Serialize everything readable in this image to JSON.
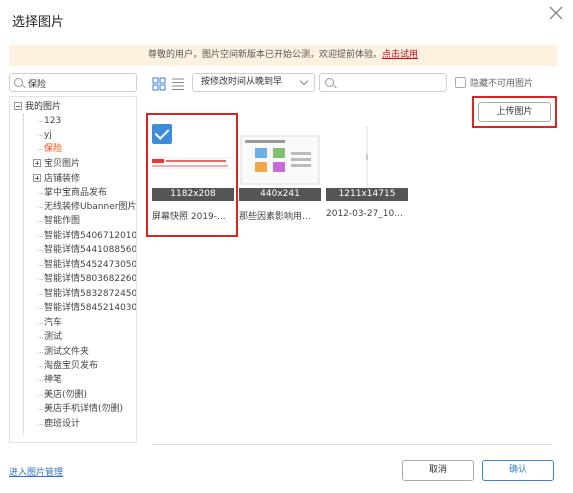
{
  "dialog": {
    "title": "选择图片"
  },
  "notice": {
    "text": "尊敬的用户，图片空间新版本已开始公测，欢迎提前体验。",
    "link": "点击试用"
  },
  "sidebar": {
    "search_value": "保险",
    "tree_root": "我的图片",
    "items": [
      {
        "label": "123"
      },
      {
        "label": "yj"
      },
      {
        "label": "保险",
        "selected": true
      },
      {
        "label": "宝贝图片",
        "collapsed": true
      },
      {
        "label": "店铺装修",
        "collapsed": true
      },
      {
        "label": "掌中宝商品发布"
      },
      {
        "label": "无线装修Ubanner图片"
      },
      {
        "label": "智能作图"
      },
      {
        "label": "智能详情5406712010"
      },
      {
        "label": "智能详情5441088560"
      },
      {
        "label": "智能详情5452473050"
      },
      {
        "label": "智能详情5803682260"
      },
      {
        "label": "智能详情5832872450"
      },
      {
        "label": "智能详情5845214030"
      },
      {
        "label": "汽车"
      },
      {
        "label": "测试"
      },
      {
        "label": "测试文件夹"
      },
      {
        "label": "淘盘宝贝发布"
      },
      {
        "label": "神笔"
      },
      {
        "label": "美店(勿删)"
      },
      {
        "label": "美店手机详情(勿删)"
      },
      {
        "label": "鹿班设计"
      }
    ]
  },
  "toolbar": {
    "sort_value": "按修改时间从晚到早",
    "hide_unavailable_label": "隐藏不可用图片",
    "upload_label": "上传图片"
  },
  "images": [
    {
      "dims": "1182x208",
      "caption": "屏幕快照 2019-...",
      "selected": true
    },
    {
      "dims": "440x241",
      "caption": "那些因素影响用..."
    },
    {
      "dims": "1211x14715",
      "caption": "2012-03-27_10..."
    }
  ],
  "footer": {
    "manage_link": "进入图片管理",
    "cancel_label": "取消",
    "ok_label": "确认"
  },
  "colors": {
    "accent": "#3a82d6",
    "highlight": "#d22222",
    "notice_bg": "#fdf2df",
    "selected_text": "#ff4400"
  },
  "icons": [
    "close-icon",
    "search-icon",
    "grid-view-icon",
    "list-view-icon",
    "chevron-down-icon",
    "checkmark-icon"
  ]
}
